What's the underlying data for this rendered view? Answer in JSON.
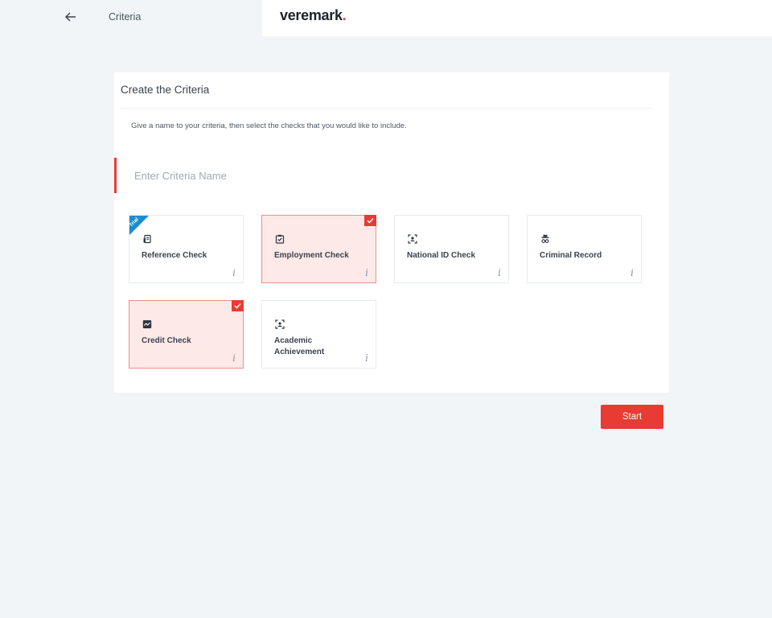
{
  "nav": {
    "title": "Criteria",
    "back_icon": "arrow-left-icon"
  },
  "brand": {
    "name": "veremark",
    "dot": ".",
    "accent_color": "#e83b34"
  },
  "card": {
    "title": "Create the Criteria",
    "description": "Give a name to your criteria, then select the checks that you would like to include.",
    "name_input": {
      "placeholder": "Enter Criteria Name",
      "value": ""
    }
  },
  "checks": [
    {
      "label": "Reference Check",
      "icon": "document-icon",
      "selected": false,
      "badge": "Trial"
    },
    {
      "label": "Employment Check",
      "icon": "clipboard-check-icon",
      "selected": true
    },
    {
      "label": "National ID Check",
      "icon": "id-scan-icon",
      "selected": false
    },
    {
      "label": "Criminal Record",
      "icon": "detective-icon",
      "selected": false
    },
    {
      "label": "Credit Check",
      "icon": "chart-line-icon",
      "selected": true
    },
    {
      "label": "Academic Achievement",
      "icon": "id-scan-icon",
      "selected": false
    }
  ],
  "info_glyph": "i",
  "actions": {
    "start_label": "Start"
  }
}
